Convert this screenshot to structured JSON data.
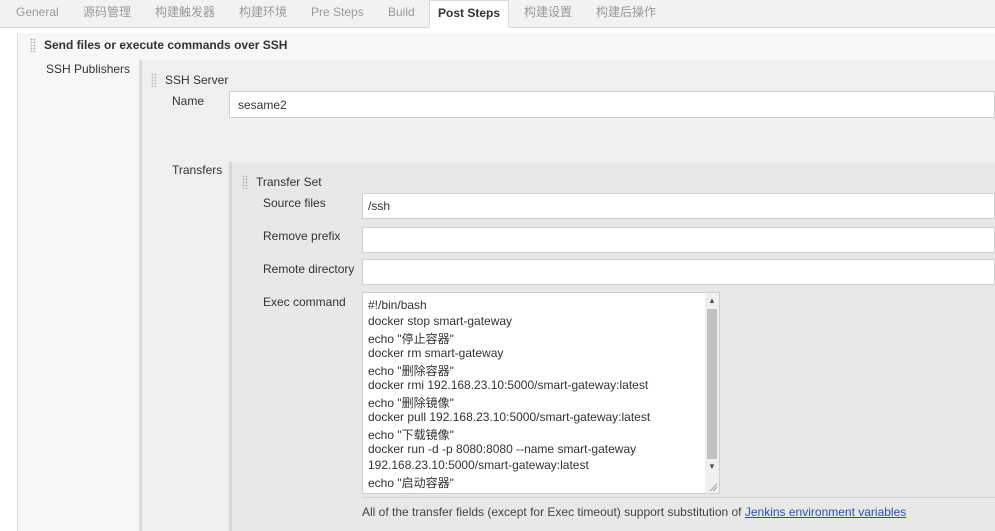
{
  "tabs": [
    {
      "label": "General"
    },
    {
      "label": "源码管理"
    },
    {
      "label": "构建触发器"
    },
    {
      "label": "构建环境"
    },
    {
      "label": "Pre Steps"
    },
    {
      "label": "Build"
    },
    {
      "label": "Post Steps"
    },
    {
      "label": "构建设置"
    },
    {
      "label": "构建后操作"
    }
  ],
  "active_tab": "Post Steps",
  "section": {
    "title": "Send files or execute commands over SSH",
    "publishers_label": "SSH Publishers"
  },
  "server": {
    "title": "SSH Server",
    "name_label": "Name",
    "name_value": "sesame2",
    "transfers_label": "Transfers"
  },
  "transfer_set": {
    "title": "Transfer Set",
    "source_files_label": "Source files",
    "source_files_value": "/ssh",
    "remove_prefix_label": "Remove prefix",
    "remove_prefix_value": "",
    "remote_directory_label": "Remote directory",
    "remote_directory_value": "",
    "exec_command_label": "Exec command",
    "exec_command_lines": [
      "#!/bin/bash",
      "docker stop smart-gateway",
      "echo \"停止容器\"",
      "docker rm smart-gateway",
      "echo \"删除容器\"",
      "docker rmi 192.168.23.10:5000/smart-gateway:latest",
      "echo \"删除镜像\"",
      "docker pull 192.168.23.10:5000/smart-gateway:latest",
      "echo \"下载镜像\"",
      "docker run -d -p 8080:8080 --name smart-gateway",
      "192.168.23.10:5000/smart-gateway:latest",
      "echo \"启动容器\""
    ]
  },
  "help": {
    "text": "All of the transfer fields (except for Exec timeout) support substitution of ",
    "link": "Jenkins environment variables"
  }
}
